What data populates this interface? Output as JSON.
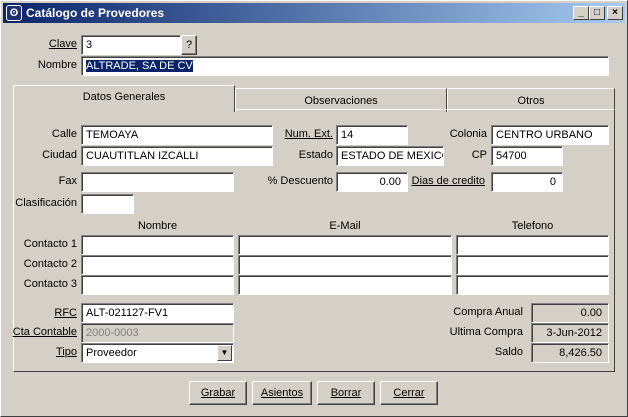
{
  "window": {
    "title": "Catálogo de Provedores",
    "icon": "app-icon",
    "controls": {
      "minimize": "_",
      "maximize": "□",
      "close": "×"
    }
  },
  "header": {
    "clave_label": "Clave",
    "clave_value": "3",
    "lookup_button": "?",
    "nombre_label": "Nombre",
    "nombre_value": "ALTRADE, SA DE CV"
  },
  "tabs": [
    {
      "label": "Datos Generales",
      "active": true
    },
    {
      "label": "Observaciones",
      "active": false
    },
    {
      "label": "Otros",
      "active": false
    }
  ],
  "address": {
    "calle_label": "Calle",
    "calle_value": "TEMOAYA",
    "numext_label": "Num. Ext.",
    "numext_value": "14",
    "colonia_label": "Colonia",
    "colonia_value": "CENTRO URBANO",
    "ciudad_label": "Ciudad",
    "ciudad_value": "CUAUTITLAN IZCALLI",
    "estado_label": "Estado",
    "estado_value": "ESTADO DE MEXICO",
    "cp_label": "CP",
    "cp_value": "54700"
  },
  "misc": {
    "fax_label": "Fax",
    "fax_value": "",
    "descuento_label": "% Descuento",
    "descuento_value": "0.00",
    "dias_label": "Dias de credito",
    "dias_value": "0",
    "clasificacion_label": "Clasificación",
    "clasificacion_value": ""
  },
  "contacts": {
    "columns": [
      "Nombre",
      "E-Mail",
      "Telefono"
    ],
    "rows": [
      {
        "label": "Contacto 1",
        "nombre": "",
        "email": "",
        "telefono": ""
      },
      {
        "label": "Contacto 2",
        "nombre": "",
        "email": "",
        "telefono": ""
      },
      {
        "label": "Contacto 3",
        "nombre": "",
        "email": "",
        "telefono": ""
      }
    ]
  },
  "fiscal": {
    "rfc_label": "RFC",
    "rfc_value": "ALT-021127-FV1",
    "cta_label": "Cta Contable",
    "cta_value": "2000-0003",
    "tipo_label": "Tipo",
    "tipo_value": "Proveedor"
  },
  "summary": {
    "compra_anual_label": "Compra Anual",
    "compra_anual_value": "0.00",
    "ultima_compra_label": "Ultima Compra",
    "ultima_compra_value": "3-Jun-2012",
    "saldo_label": "Saldo",
    "saldo_value": "8,426.50"
  },
  "buttons": {
    "grabar": "Grabar",
    "asientos": "Asientos",
    "borrar": "Borrar",
    "cerrar": "Cerrar"
  }
}
